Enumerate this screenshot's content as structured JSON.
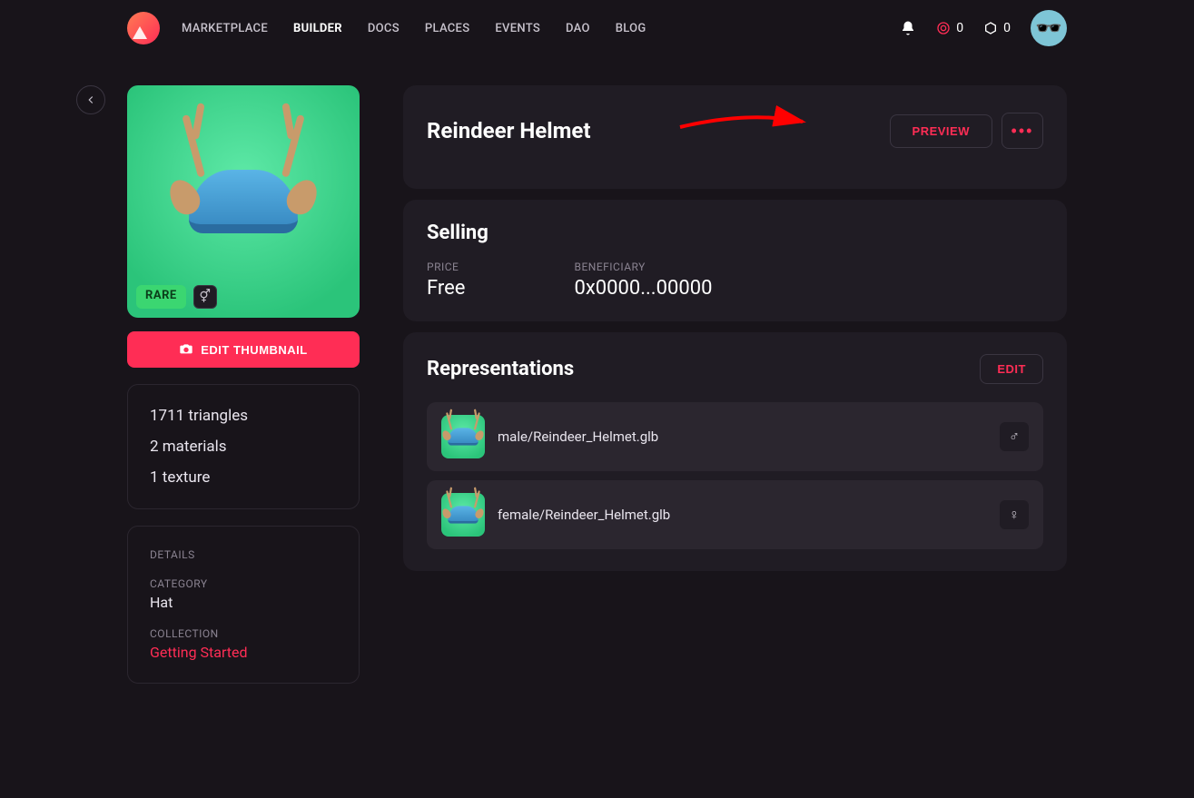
{
  "nav": {
    "links": [
      "MARKETPLACE",
      "BUILDER",
      "DOCS",
      "PLACES",
      "EVENTS",
      "DAO",
      "BLOG"
    ],
    "active": "BUILDER",
    "mana_count": "0",
    "poly_count": "0"
  },
  "item": {
    "title": "Reindeer Helmet",
    "rarity": "RARE",
    "gender_icon": "⚥",
    "edit_thumbnail": "EDIT THUMBNAIL",
    "preview_label": "PREVIEW"
  },
  "stats": {
    "triangles": "1711 triangles",
    "materials": "2 materials",
    "textures": "1 texture"
  },
  "details": {
    "heading": "DETAILS",
    "category_label": "CATEGORY",
    "category_value": "Hat",
    "collection_label": "COLLECTION",
    "collection_value": "Getting Started"
  },
  "selling": {
    "heading": "Selling",
    "price_label": "PRICE",
    "price_value": "Free",
    "beneficiary_label": "BENEFICIARY",
    "beneficiary_value": "0x0000...00000"
  },
  "representations": {
    "heading": "Representations",
    "edit_label": "EDIT",
    "items": [
      {
        "file": "male/Reindeer_Helmet.glb",
        "gender": "♂"
      },
      {
        "file": "female/Reindeer_Helmet.glb",
        "gender": "♀"
      }
    ]
  }
}
